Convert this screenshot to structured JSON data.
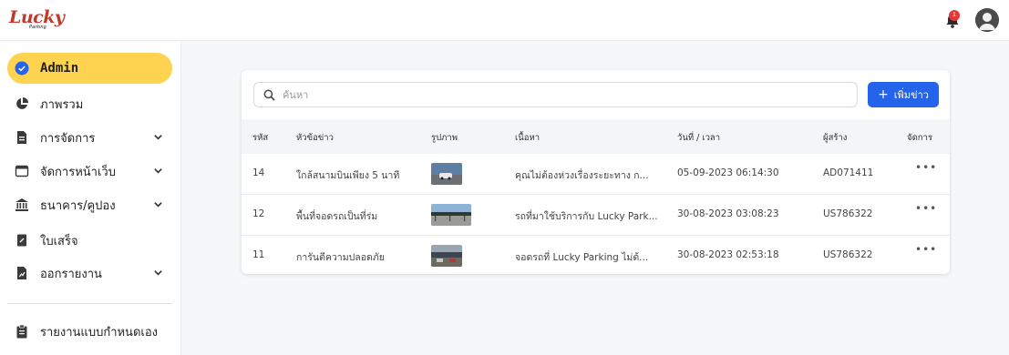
{
  "brand": {
    "name": "Lucky",
    "tagline": "Parking",
    "color": "#c0392b"
  },
  "header": {
    "notification_count": "1"
  },
  "sidebar": {
    "active_item": "Admin",
    "items": [
      {
        "label": "Admin",
        "icon": "verified-badge-icon"
      },
      {
        "label": "ภาพรวม",
        "icon": "pie-chart-icon"
      },
      {
        "label": "การจัดการ",
        "icon": "document-icon",
        "expandable": true
      },
      {
        "label": "จัดการหน้าเว็บ",
        "icon": "browser-window-icon",
        "expandable": true
      },
      {
        "label": "ธนาคาร/คูปอง",
        "icon": "bank-icon",
        "expandable": true
      },
      {
        "label": "ใบเสร็จ",
        "icon": "receipt-icon"
      },
      {
        "label": "ออกรายงาน",
        "icon": "report-file-icon",
        "expandable": true
      },
      {
        "label": "รายงานแบบกำหนดเอง",
        "icon": "clipboard-icon"
      }
    ]
  },
  "search": {
    "placeholder": "ค้นหา"
  },
  "add_button": {
    "label": "เพิ่มข่าว"
  },
  "table": {
    "columns": [
      "รหัส",
      "หัวข้อข่าว",
      "รูปภาพ",
      "เนื้อหา",
      "วันที่ / เวลา",
      "ผู้สร้าง",
      "จัดการ"
    ],
    "rows": [
      {
        "id": "14",
        "title": "ใกล้สนามบินเพียง 5 นาที",
        "content": "คุณไม่ต้องห่วงเรื่องระยะทาง ก...",
        "datetime": "05-09-2023 06:14:30",
        "creator": "AD071411"
      },
      {
        "id": "12",
        "title": "พื้นที่จอดรถเป็นที่ร่ม",
        "content": "รถที่มาใช้บริการกับ Lucky Park...",
        "datetime": "30-08-2023 03:08:23",
        "creator": "US786322"
      },
      {
        "id": "11",
        "title": "การันตีความปลอดภัย",
        "content": "จอดรถที่ Lucky Parking ไม่ต้...",
        "datetime": "30-08-2023 02:53:18",
        "creator": "US786322"
      }
    ],
    "action_symbol": "•••"
  },
  "colors": {
    "accent": "#fdd34f",
    "primary": "#2563eb",
    "badge": "#e53935"
  }
}
